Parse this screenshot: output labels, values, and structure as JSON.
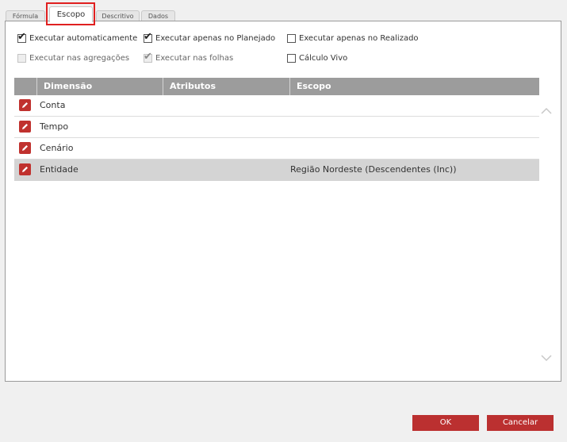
{
  "tabs": [
    {
      "label": "Fórmula",
      "active": false
    },
    {
      "label": "Escopo",
      "active": true
    },
    {
      "label": "Descritivo",
      "active": false
    },
    {
      "label": "Dados",
      "active": false
    }
  ],
  "options": {
    "executar_automaticamente": {
      "label": "Executar automaticamente",
      "checked": true,
      "disabled": false
    },
    "executar_planejado": {
      "label": "Executar apenas no Planejado",
      "checked": true,
      "disabled": false
    },
    "executar_realizado": {
      "label": "Executar apenas no Realizado",
      "checked": false,
      "disabled": false
    },
    "executar_agregacoes": {
      "label": "Executar nas agregações",
      "checked": false,
      "disabled": true
    },
    "executar_folhas": {
      "label": "Executar nas folhas",
      "checked": true,
      "disabled": true
    },
    "calculo_vivo": {
      "label": "Cálculo Vivo",
      "checked": false,
      "disabled": false
    }
  },
  "grid": {
    "columns": [
      "Dimensão",
      "Atributos",
      "Escopo"
    ],
    "rows": [
      {
        "dimensao": "Conta",
        "atributos": "",
        "escopo": ""
      },
      {
        "dimensao": "Tempo",
        "atributos": "",
        "escopo": ""
      },
      {
        "dimensao": "Cenário",
        "atributos": "",
        "escopo": ""
      },
      {
        "dimensao": "Entidade",
        "atributos": "",
        "escopo": "Região Nordeste (Descendentes (Inc))",
        "selected": true
      }
    ]
  },
  "buttons": {
    "ok": "OK",
    "cancel": "Cancelar"
  },
  "icons": {
    "edit": "pencil-icon",
    "scroll_up": "chevron-up-icon",
    "scroll_down": "chevron-down-icon"
  },
  "colors": {
    "accent": "#bb3030",
    "header": "#9c9c9c",
    "selected_row": "#d4d4d4",
    "highlight": "#e02020"
  }
}
